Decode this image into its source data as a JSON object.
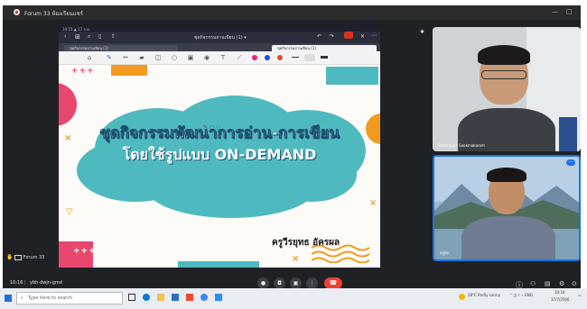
{
  "window": {
    "title": "Forum 33 ห้องเรียนแชร์"
  },
  "tablet": {
    "status_time": "10:15 ▲ 17 ก.ค.",
    "doc_title": "ชุดกิจกรรมอ่านเขียน (1) ▾",
    "tab_left": "ชุดกิจกรรมอ่านเขียน (1)",
    "tab_right": "ชุดกิจกรรมอ่านเขียน (1)"
  },
  "slide": {
    "line1": "ชุดกิจกรรมพัฒนาการอ่าน-การเขียน",
    "line2": "โดยใช้รูปแบบ ON-DEMAND",
    "author": "ครูวีรยุทธ อัครผล",
    "plus_top": "+++",
    "plus_bottom": "+++"
  },
  "participants": [
    {
      "name": "Pattarapon Sookmakarom"
    },
    {
      "name": "ครูต่อ"
    }
  ],
  "presenting_label": "Forum 33",
  "meeting": {
    "time": "10:16",
    "code": "ybh-dwjn-gmd"
  },
  "taskbar": {
    "search_placeholder": "Type here to search",
    "weather": "28°C  Partly sunny",
    "time": "10:16",
    "date": "17/7/2566"
  },
  "colors": {
    "accent": "#1a73e8",
    "hangup": "#ea4335",
    "cloud": "#4fb9c0",
    "slide_orange": "#f29b1e",
    "slide_pink": "#e8476e"
  }
}
